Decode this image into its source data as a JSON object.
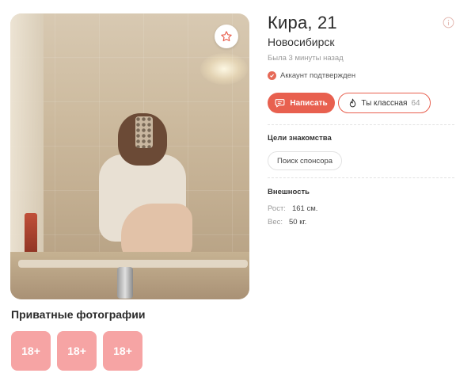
{
  "profile": {
    "name_age": "Кира, 21",
    "city": "Новосибирск",
    "last_seen": "Была 3 минуты назад",
    "verified_label": "Аккаунт подтвержден"
  },
  "actions": {
    "write_label": "Написать",
    "like_label": "Ты классная",
    "like_count": "64"
  },
  "goals": {
    "title": "Цели знакомства",
    "chips": [
      "Поиск спонсора"
    ]
  },
  "appearance": {
    "title": "Внешность",
    "rows": [
      {
        "key": "Рост:",
        "value": "161 см."
      },
      {
        "key": "Вес:",
        "value": "50 кг."
      }
    ]
  },
  "private_photos": {
    "title": "Приватные фотографии",
    "tiles": [
      "18+",
      "18+",
      "18+"
    ]
  },
  "icons": {
    "favorite": "star-icon",
    "info": "info-icon",
    "verified": "check-icon",
    "write": "chat-bubble-icon",
    "like": "flame-icon"
  },
  "colors": {
    "accent": "#e8604f",
    "private_tile": "#f6a4a4"
  }
}
